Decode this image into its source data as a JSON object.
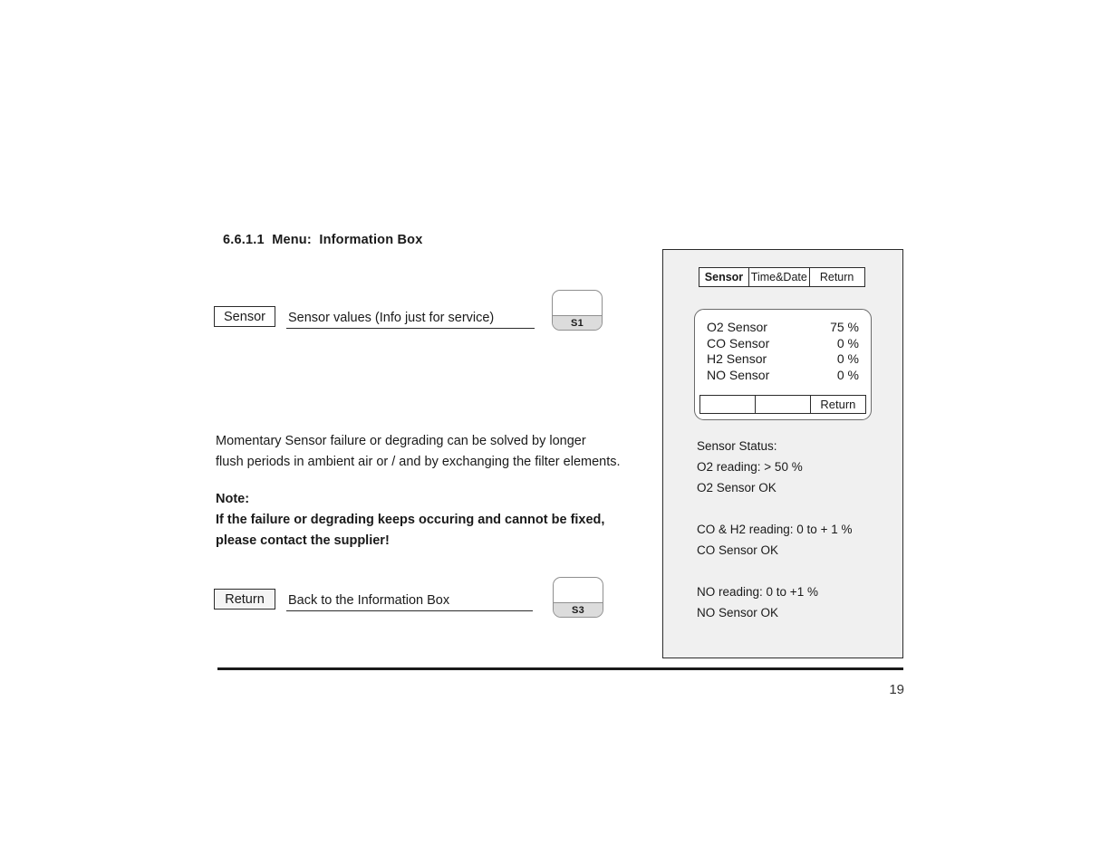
{
  "document": {
    "section_heading": "6.6.1.1  Menu:  Information Box",
    "page_number": "19"
  },
  "key_rows": [
    {
      "key_label": "Sensor",
      "description": "Sensor  values (Info just for service)",
      "button_label": "S1"
    },
    {
      "key_label": "Return",
      "description": "Back to the Information Box",
      "button_label": "S3"
    }
  ],
  "body": {
    "paragraph_lines": [
      "Momentary Sensor failure or degrading can be solved by longer",
      "flush periods in ambient air or / and by exchanging the filter elements."
    ],
    "note_lines": [
      "Note:",
      "If the failure or degrading keeps occuring and cannot be fixed,",
      "please contact the supplier!"
    ]
  },
  "device": {
    "tabs": [
      {
        "label": "Sensor",
        "active": true
      },
      {
        "label": "Time&Date",
        "active": false
      },
      {
        "label": "Return",
        "active": false
      }
    ],
    "lcd": {
      "rows": [
        {
          "label": "O2 Sensor",
          "value": "75 %"
        },
        {
          "label": "CO Sensor",
          "value": "0 %"
        },
        {
          "label": "H2 Sensor",
          "value": "0 %"
        },
        {
          "label": "NO Sensor",
          "value": "0 %"
        }
      ],
      "softkeys": [
        "",
        "",
        "Return"
      ]
    },
    "status": {
      "groups": [
        [
          "Sensor Status:",
          "O2 reading: > 50 %",
          "O2 Sensor OK"
        ],
        [
          "CO & H2 reading: 0 to + 1 %",
          "CO Sensor OK"
        ],
        [
          "NO reading: 0 to +1 %",
          "NO Sensor OK"
        ]
      ]
    }
  }
}
